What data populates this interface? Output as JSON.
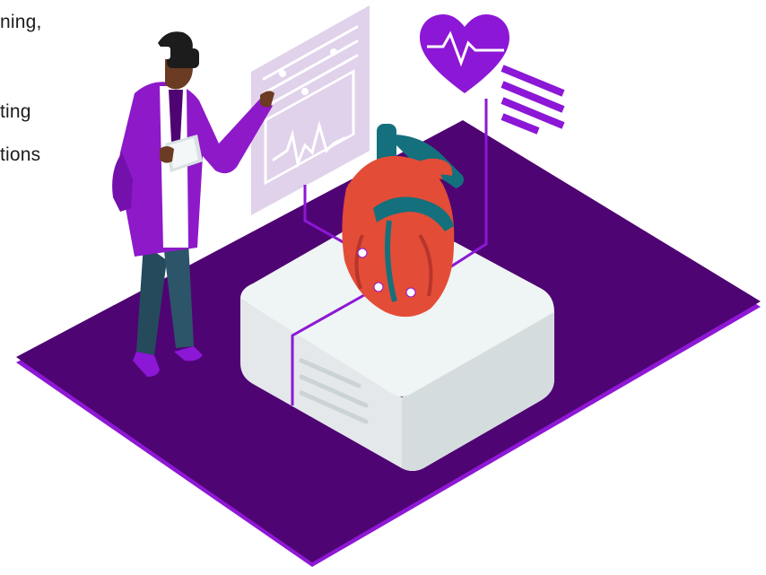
{
  "text_fragments": [
    "ning,",
    "ting",
    "tions"
  ],
  "colors": {
    "platform_top": "#4f0473",
    "platform_edge": "#8e18d4",
    "pedestal_top": "#eff4f4",
    "pedestal_side_left": "#e4e8ea",
    "pedestal_side_right": "#d5dcde",
    "heart_red": "#e34c37",
    "heart_dark": "#b8352b",
    "vessel_teal": "#14707c",
    "accent_purple": "#8c17d6",
    "panel_lilac": "#ded0ea",
    "coat_purple": "#8d19c9",
    "trouser_teal": "#254a5c",
    "skin": "#6b3b23"
  },
  "icons": [
    "heart-rate-icon",
    "text-lines-icon",
    "vr-headset-icon",
    "tablet-icon"
  ]
}
